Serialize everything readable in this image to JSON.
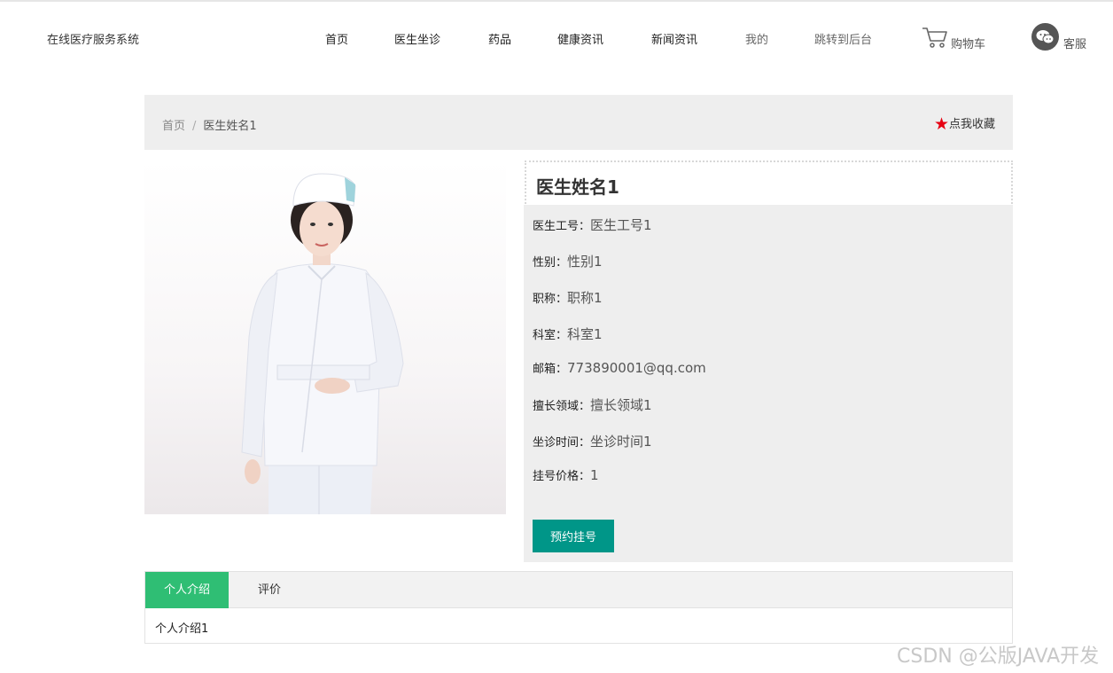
{
  "header": {
    "site_title": "在线医疗服务系统",
    "nav": [
      {
        "label": "首页"
      },
      {
        "label": "医生坐诊"
      },
      {
        "label": "药品"
      },
      {
        "label": "健康资讯"
      },
      {
        "label": "新闻资讯"
      },
      {
        "label": "我的"
      },
      {
        "label": "跳转到后台"
      }
    ],
    "cart_label": "购物车",
    "service_label": "客服"
  },
  "breadcrumb": {
    "home": "首页",
    "separator": "/",
    "current": "医生姓名1"
  },
  "favorite_label": "点我收藏",
  "doctor": {
    "name": "医生姓名1",
    "fields": [
      {
        "label": "医生工号：",
        "value": "医生工号1"
      },
      {
        "label": "性别：",
        "value": "性别1"
      },
      {
        "label": "职称：",
        "value": "职称1"
      },
      {
        "label": "科室：",
        "value": "科室1"
      },
      {
        "label": "邮箱：",
        "value": "773890001@qq.com"
      },
      {
        "label": "擅长领域：",
        "value": "擅长领域1"
      },
      {
        "label": "坐诊时间：",
        "value": "坐诊时间1"
      },
      {
        "label": "挂号价格：",
        "value": "1"
      }
    ],
    "book_button": "预约挂号"
  },
  "tabs": {
    "items": [
      {
        "label": "个人介绍",
        "active": true
      },
      {
        "label": "评价",
        "active": false
      }
    ],
    "content": "个人介绍1"
  },
  "watermark": "CSDN @公版JAVA开发",
  "colors": {
    "primary_button": "#009688",
    "active_tab": "#2fbe74",
    "favorite_star": "#e60012"
  }
}
